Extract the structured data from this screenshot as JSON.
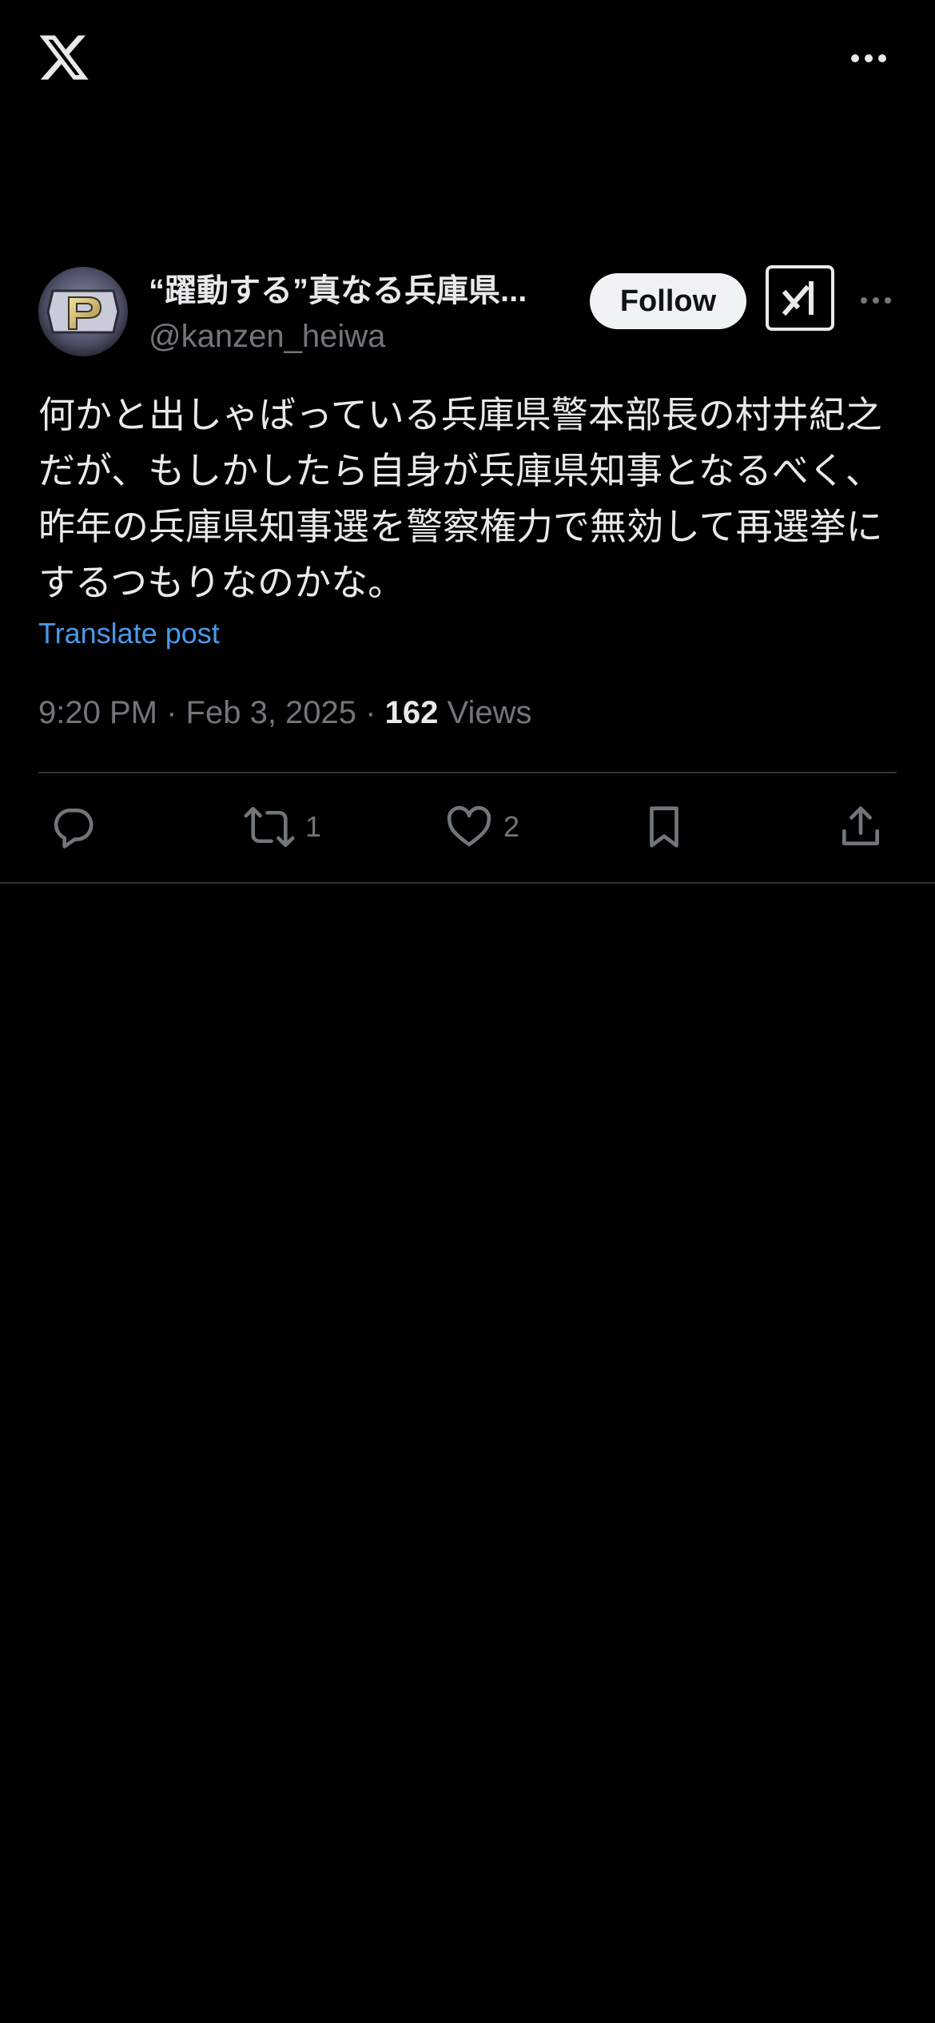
{
  "icons": {
    "logo": "x-logo-icon",
    "more": "more-horizontal-icon",
    "grok": "grok-icon",
    "reply": "reply-icon",
    "repost": "repost-icon",
    "like": "heart-icon",
    "bookmark": "bookmark-icon",
    "share": "share-icon"
  },
  "colors": {
    "background": "#000000",
    "text": "#e7e9ea",
    "secondary": "#71767b",
    "link": "#4a99e9",
    "divider": "#2f3336"
  },
  "author": {
    "display_name": "“躍動する”真なる兵庫県...",
    "handle": "@kanzen_heiwa",
    "follow_label": "Follow"
  },
  "post": {
    "text": "何かと出しゃばっている兵庫県警本部長の村井紀之だが、もしかしたら自身が兵庫県知事となるべく、昨年の兵庫県知事選を警察権力で無効して再選挙にするつもりなのかな。",
    "translate_label": "Translate post",
    "time": "9:20 PM",
    "date": "Feb 3, 2025",
    "views_count": "162",
    "views_label": "Views",
    "separator": "·"
  },
  "actions": {
    "reposts": "1",
    "likes": "2"
  }
}
